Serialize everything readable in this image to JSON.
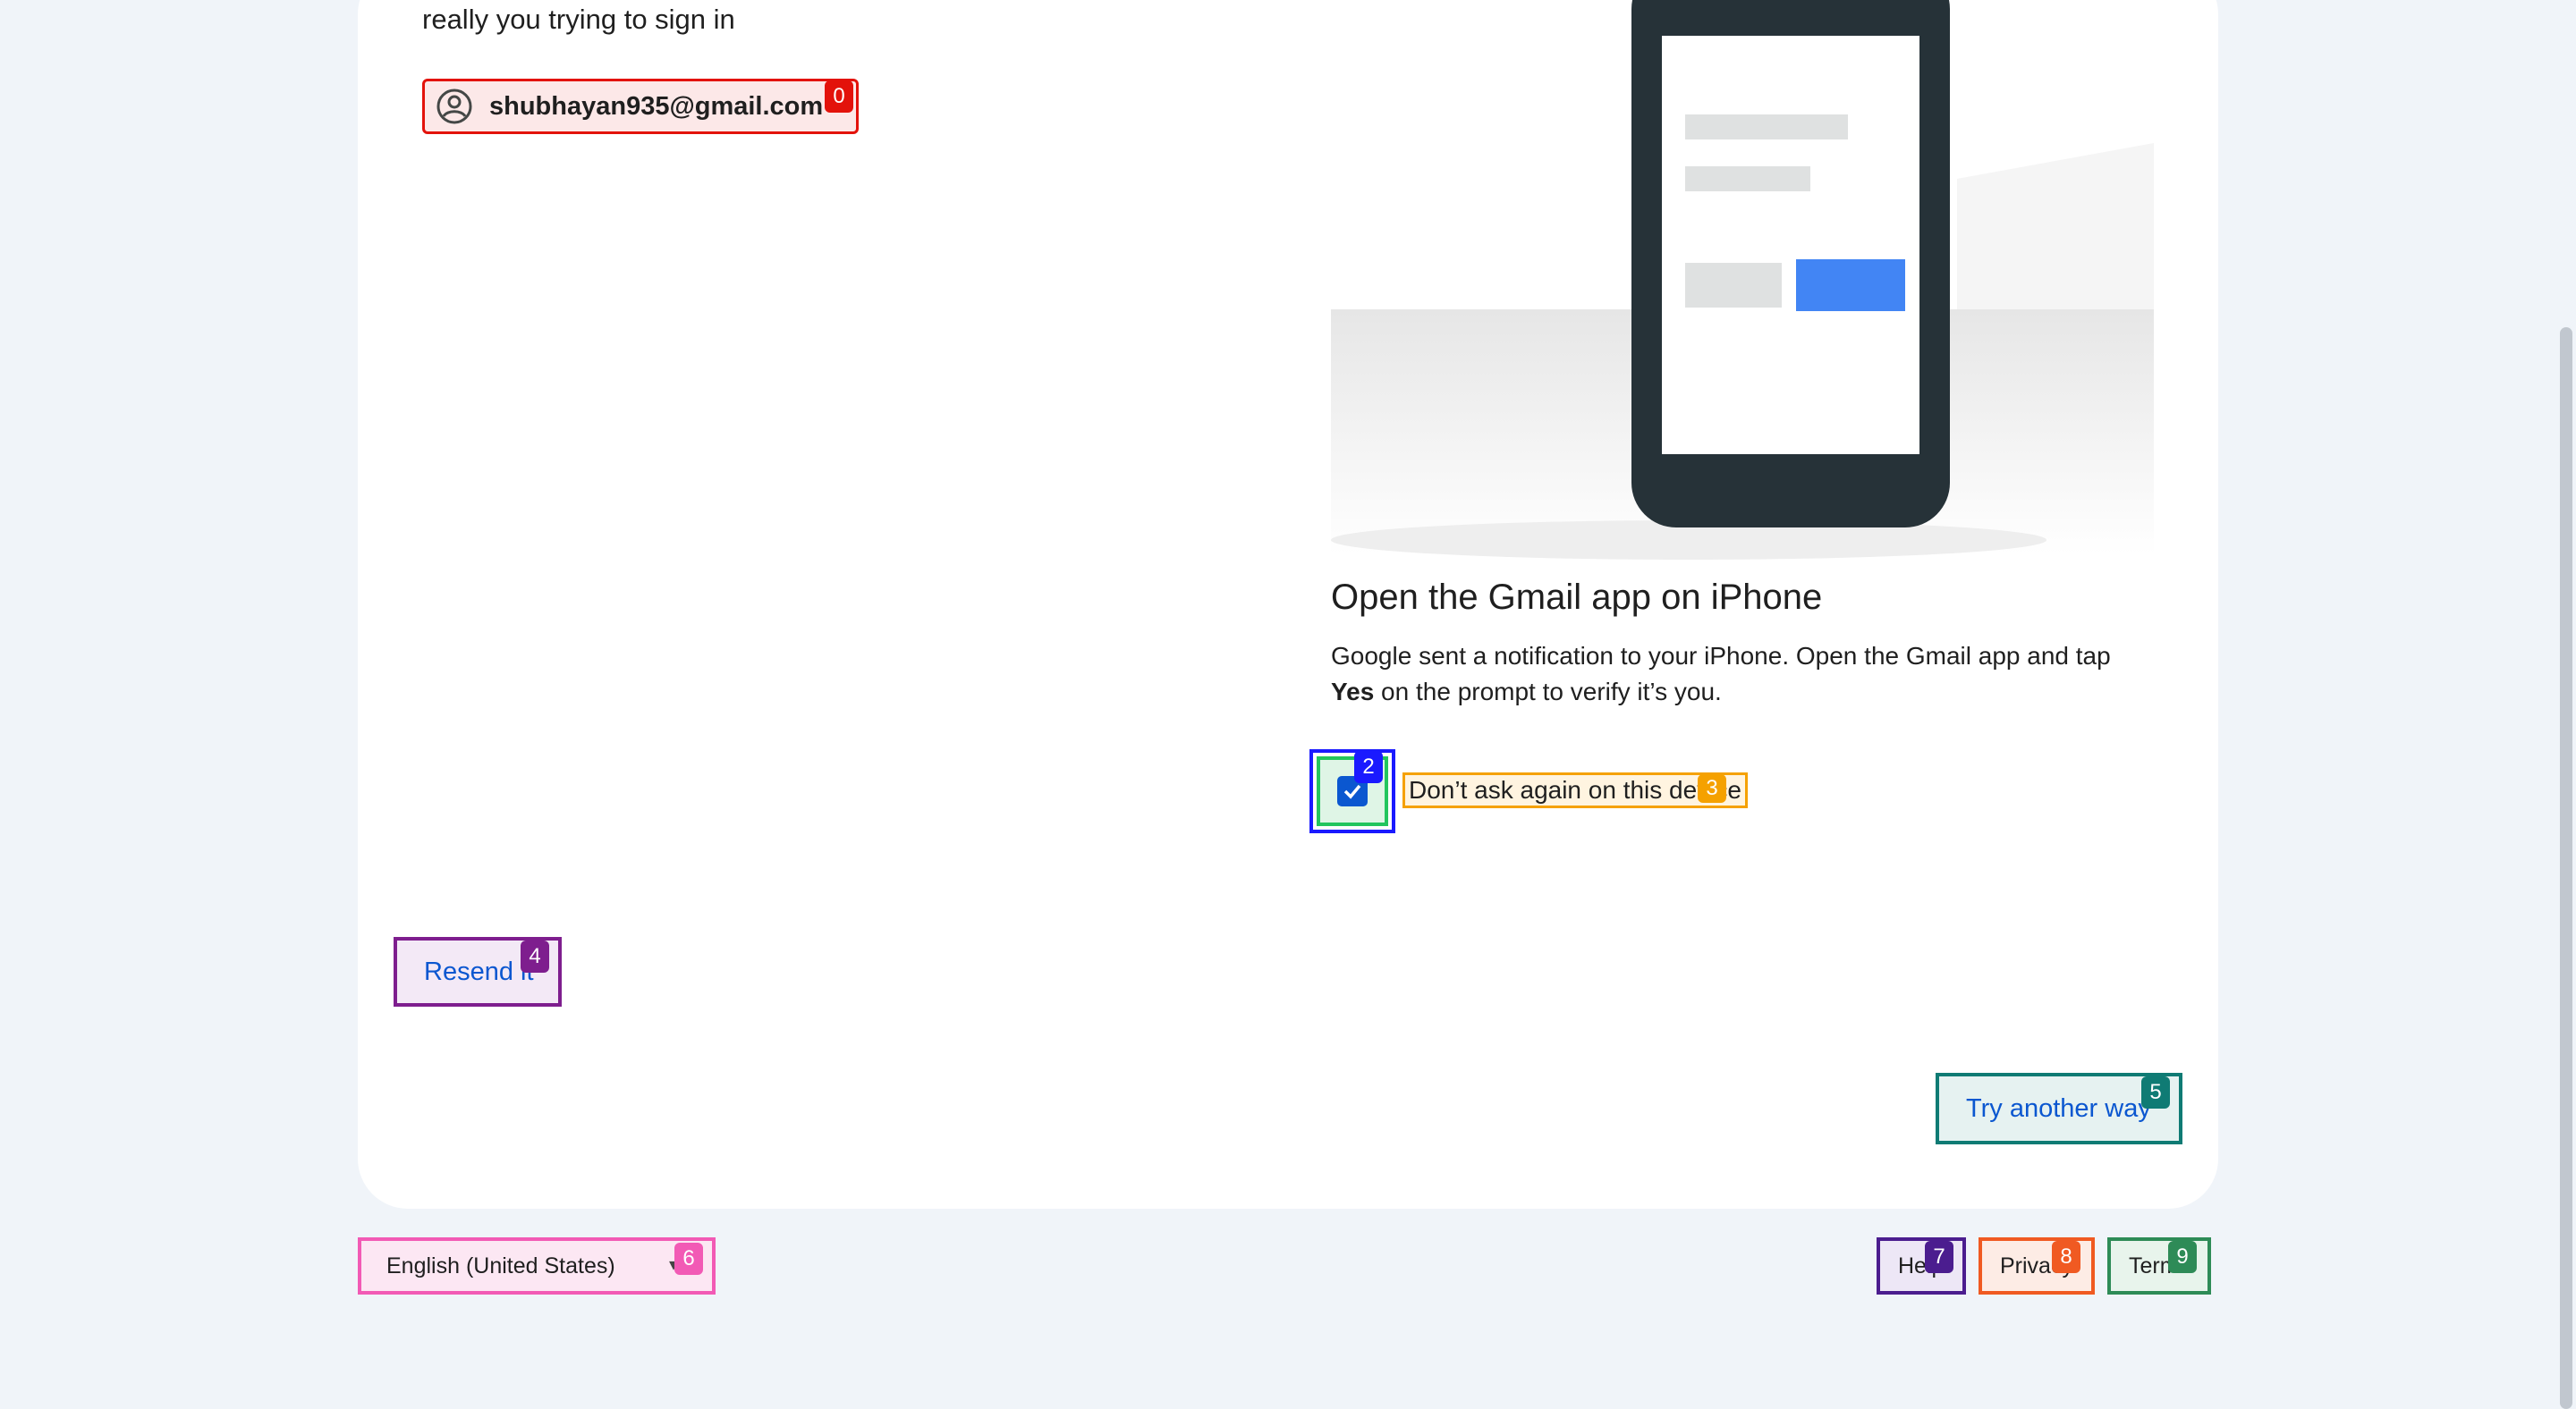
{
  "intro_text": "really you trying to sign in",
  "account": {
    "email": "shubhayan935@gmail.com",
    "icon": "account-circle-icon"
  },
  "markers": {
    "m0": {
      "label": "0",
      "color": "#e3120b"
    },
    "m2": {
      "label": "2",
      "color": "#1a1aff"
    },
    "m3": {
      "label": "3",
      "color": "#f5a100"
    },
    "m4": {
      "label": "4",
      "color": "#7e1e8e"
    },
    "m5": {
      "label": "5",
      "color": "#0f7b74"
    },
    "m6": {
      "label": "6",
      "color": "#f25ab5"
    },
    "m7": {
      "label": "7",
      "color": "#4b1d8f"
    },
    "m8": {
      "label": "8",
      "color": "#f05a22"
    },
    "m9": {
      "label": "9",
      "color": "#2e8b57"
    }
  },
  "prompt": {
    "heading": "Open the Gmail app on iPhone",
    "desc_line1": "Google sent a notification to your iPhone. Open the Gmail app and tap",
    "desc_bold": "Yes",
    "desc_line2": " on the prompt to verify it’s you."
  },
  "checkbox": {
    "label": "Don’t ask again on this device",
    "checked": true
  },
  "buttons": {
    "resend": "Resend it",
    "try_another": "Try another way"
  },
  "footer": {
    "language": "English (United States)",
    "help": "Help",
    "privacy": "Privacy",
    "terms": "Terms"
  },
  "colors": {
    "accent": "#0b57d0",
    "background": "#f0f4f9",
    "phone": "#263238",
    "phone_button": "#4285f4"
  }
}
